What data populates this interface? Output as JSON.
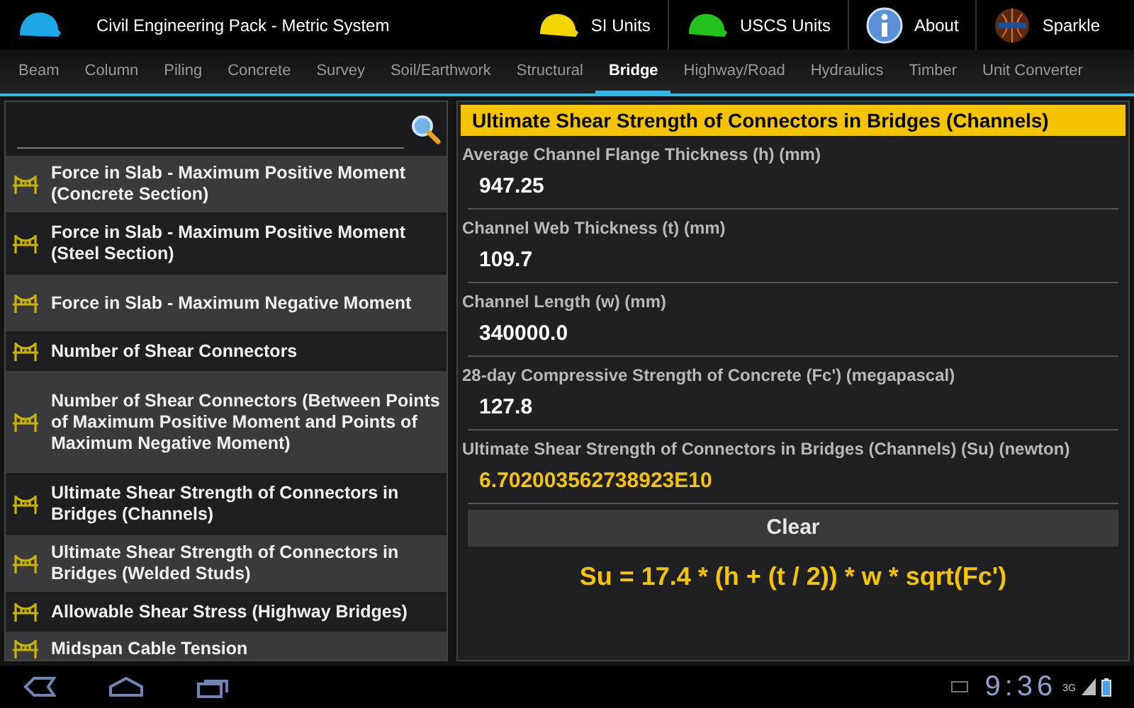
{
  "app_bar": {
    "title": "Civil Engineering Pack - Metric System",
    "actions": [
      {
        "label": "SI Units",
        "kind": "helmet",
        "color": "#f2d600"
      },
      {
        "label": "USCS Units",
        "kind": "helmet",
        "color": "#22c41c"
      },
      {
        "label": "About",
        "kind": "info"
      },
      {
        "label": "Sparkle",
        "kind": "globe"
      }
    ]
  },
  "tabs": [
    {
      "label": "Beam",
      "selected": false
    },
    {
      "label": "Column",
      "selected": false
    },
    {
      "label": "Piling",
      "selected": false
    },
    {
      "label": "Concrete",
      "selected": false
    },
    {
      "label": "Survey",
      "selected": false
    },
    {
      "label": "Soil/Earthwork",
      "selected": false
    },
    {
      "label": "Structural",
      "selected": false
    },
    {
      "label": "Bridge",
      "selected": true
    },
    {
      "label": "Highway/Road",
      "selected": false
    },
    {
      "label": "Hydraulics",
      "selected": false
    },
    {
      "label": "Timber",
      "selected": false
    },
    {
      "label": "Unit Converter",
      "selected": false
    }
  ],
  "formula_list": {
    "items": [
      {
        "label": "Force in Slab - Maximum Positive Moment (Concrete Section)"
      },
      {
        "label": "Force in Slab - Maximum Positive Moment (Steel Section)"
      },
      {
        "label": "Force in Slab - Maximum Negative Moment"
      },
      {
        "label": "Number of Shear Connectors"
      },
      {
        "label": "Number of Shear Connectors (Between Points of Maximum Positive Moment and Points of Maximum Negative Moment)"
      },
      {
        "label": "Ultimate Shear Strength of Connectors in Bridges (Channels)"
      },
      {
        "label": "Ultimate Shear Strength of Connectors in Bridges (Welded Studs)"
      },
      {
        "label": "Allowable Shear Stress (Highway Bridges)"
      },
      {
        "label": "Midspan Cable Tension"
      }
    ]
  },
  "calculator": {
    "title": "Ultimate Shear Strength of Connectors in Bridges (Channels)",
    "fields": [
      {
        "label": "Average Channel Flange Thickness (h) (mm)",
        "value": "947.25",
        "kind": "input"
      },
      {
        "label": "Channel Web Thickness (t) (mm)",
        "value": "109.7",
        "kind": "input"
      },
      {
        "label": "Channel Length (w) (mm)",
        "value": "340000.0",
        "kind": "input"
      },
      {
        "label": "28-day Compressive Strength of Concrete (Fc') (megapascal)",
        "value": "127.8",
        "kind": "input"
      },
      {
        "label": "Ultimate Shear Strength of Connectors in Bridges (Channels) (Su) (newton)",
        "value": "6.702003562738923E10",
        "kind": "result"
      }
    ],
    "button": "Clear",
    "formula": "Su = 17.4 * (h + (t / 2)) * w * sqrt(Fc')"
  },
  "system_bar": {
    "time": "9:36",
    "network": "3G"
  }
}
